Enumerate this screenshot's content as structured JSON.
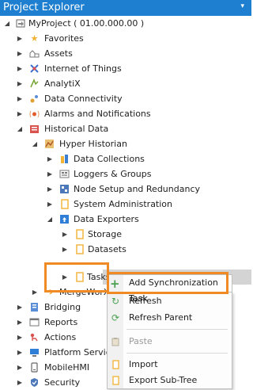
{
  "panel": {
    "title": "Project Explorer",
    "pin_glyph": "▾"
  },
  "tree": {
    "root": "MyProject ( 01.00.000.00 )",
    "favorites": "Favorites",
    "assets": "Assets",
    "iot": "Internet of Things",
    "analytix": "AnalytiX",
    "data_connectivity": "Data Connectivity",
    "alarms": "Alarms and Notifications",
    "historical_data": "Historical Data",
    "hyper_historian": "Hyper Historian",
    "data_collections": "Data Collections",
    "loggers_groups": "Loggers & Groups",
    "node_setup": "Node Setup and Redundancy",
    "system_admin": "System Administration",
    "data_exporters": "Data Exporters",
    "storage": "Storage",
    "datasets": "Datasets",
    "tasks": "Tasks",
    "mergeworx": "MergeWorX",
    "bridging": "Bridging",
    "reports": "Reports",
    "actions": "Actions",
    "platform_services": "Platform Services",
    "mobilehmi": "MobileHMI",
    "security": "Security"
  },
  "context_menu": {
    "add_sync_task": "Add Synchronization Task",
    "refresh": "Refresh",
    "refresh_parent": "Refresh Parent",
    "paste": "Paste",
    "import": "Import",
    "export_subtree": "Export Sub-Tree"
  },
  "colors": {
    "title_bar": "#1e7fd0",
    "highlight": "#f08a24",
    "selection": "#d4d4d4",
    "folder": "#f2b233"
  }
}
